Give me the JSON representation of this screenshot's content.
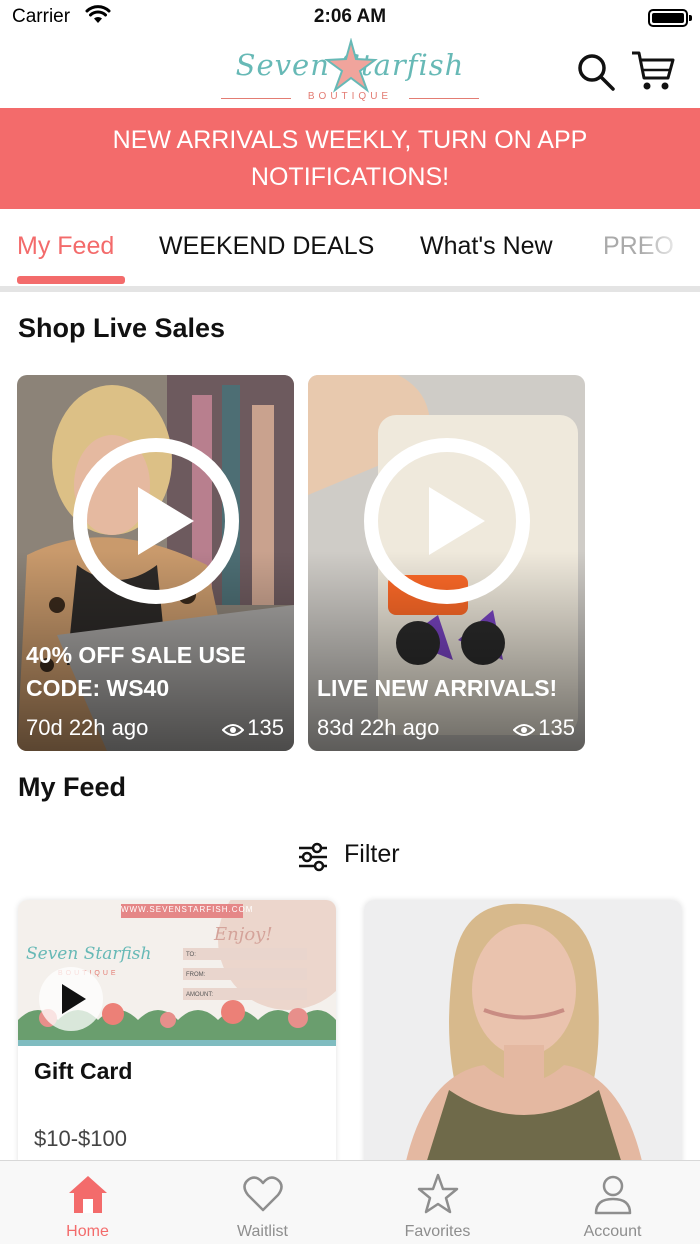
{
  "status_bar": {
    "carrier": "Carrier",
    "time": "2:06 AM"
  },
  "header": {
    "logo_text": "Seven Starfish",
    "logo_subtitle": "BOUTIQUE",
    "icons": {
      "search": "search-icon",
      "cart": "cart-icon"
    }
  },
  "banner": {
    "text": "NEW ARRIVALS WEEKLY, TURN ON APP NOTIFICATIONS!"
  },
  "tabs": [
    {
      "label": "My Feed",
      "active": true
    },
    {
      "label": "WEEKEND DEALS",
      "active": false
    },
    {
      "label": "What's New",
      "active": false
    },
    {
      "label": "PREO",
      "active": false
    }
  ],
  "live_section": {
    "title": "Shop Live Sales",
    "cards": [
      {
        "title": "40% OFF SALE USE CODE: WS40",
        "time_ago": "70d 22h ago",
        "views": "135"
      },
      {
        "title": "LIVE NEW ARRIVALS!",
        "time_ago": "83d 22h ago",
        "views": "135"
      }
    ]
  },
  "feed_section": {
    "title": "My Feed",
    "filter_label": "Filter",
    "products": [
      {
        "name": "Gift Card",
        "price": "$10-$100",
        "image_text": {
          "url": "WWW.SEVENSTARFISH.COM",
          "enjoy": "Enjoy!",
          "to": "TO:",
          "from": "FROM:",
          "amount": "AMOUNT:",
          "logo": "Seven Starfish",
          "logo_sub": "BOUTIQUE"
        }
      },
      {
        "name": "",
        "price": ""
      }
    ]
  },
  "bottom_nav": [
    {
      "label": "Home",
      "icon": "home-icon",
      "active": true
    },
    {
      "label": "Waitlist",
      "icon": "heart-icon",
      "active": false
    },
    {
      "label": "Favorites",
      "icon": "star-icon",
      "active": false
    },
    {
      "label": "Account",
      "icon": "person-icon",
      "active": false
    }
  ],
  "colors": {
    "accent": "#f36b6b",
    "logo_teal": "#67b9b6",
    "inactive": "#8e8e8e"
  }
}
